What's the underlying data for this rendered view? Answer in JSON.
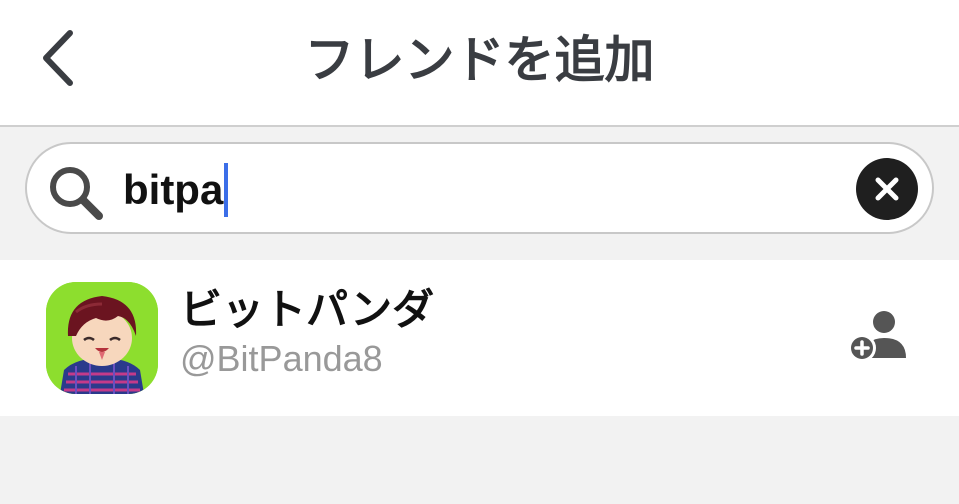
{
  "header": {
    "title": "フレンドを追加"
  },
  "search": {
    "value": "bitpa"
  },
  "results": [
    {
      "display_name": "ビットパンダ",
      "user_id": "@BitPanda8"
    }
  ],
  "colors": {
    "caret": "#3b6ee8",
    "title_text": "#3a3d42",
    "secondary_text": "#999999",
    "background": "#f2f2f2"
  },
  "icons": {
    "back": "chevron-left-icon",
    "search": "search-icon",
    "clear": "clear-circle-icon",
    "add_friend": "add-person-icon"
  }
}
